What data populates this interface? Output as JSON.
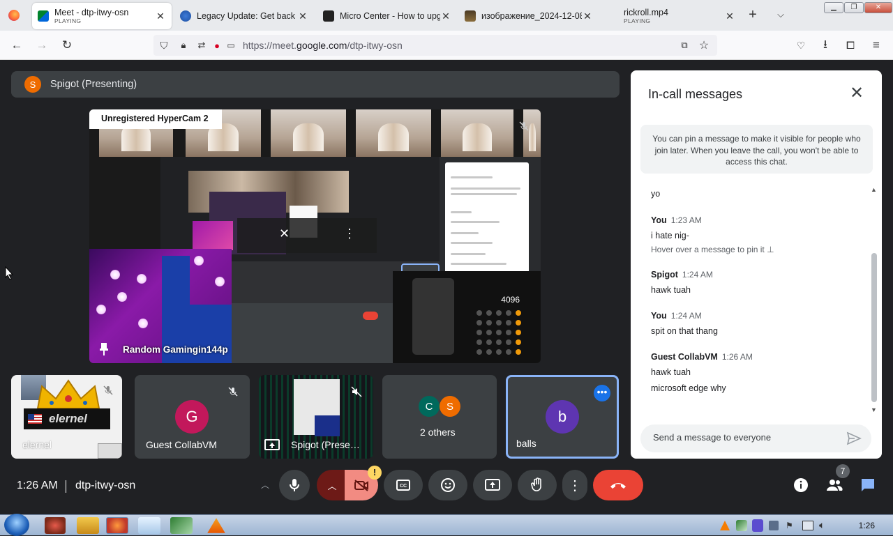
{
  "browser": {
    "tabs": [
      {
        "title": "Meet - dtp-itwy-osn",
        "status": "PLAYING",
        "active": true
      },
      {
        "title": "Legacy Update: Get back o",
        "status": ""
      },
      {
        "title": "Micro Center - How to upg",
        "status": ""
      },
      {
        "title": "изображение_2024-12-08_",
        "status": ""
      },
      {
        "title": "rickroll.mp4",
        "status": "PLAYING"
      }
    ],
    "url_prefix": "https://meet.",
    "url_domain": "google.com",
    "url_path": "/dtp-itwy-osn"
  },
  "meet": {
    "presenting_initial": "S",
    "presenting_label": "Spigot (Presenting)",
    "share": {
      "hypercam_label": "Unregistered HyperCam 2",
      "presenter_name": "Random Gamingin144p",
      "calc_display": "4096"
    },
    "tiles": [
      {
        "name": "elernel",
        "badge": "elernel"
      },
      {
        "name": "Guest CollabVM",
        "initial": "G"
      },
      {
        "name": "Spigot (Prese…"
      },
      {
        "name": "2 others",
        "initials": [
          "C",
          "S"
        ]
      },
      {
        "name": "balls",
        "initial": "b"
      }
    ],
    "chat": {
      "title": "In-call messages",
      "pin_note": "You can pin a message to make it visible for people who join later. When you leave the call, you won't be able to access this chat.",
      "messages": [
        {
          "text": "yo"
        },
        {
          "sender": "You",
          "time": "1:23 AM",
          "lines": [
            "i hate nig-"
          ],
          "hint": "Hover over a message to pin it"
        },
        {
          "sender": "Spigot",
          "time": "1:24 AM",
          "lines": [
            "hawk tuah"
          ]
        },
        {
          "sender": "You",
          "time": "1:24 AM",
          "lines": [
            "spit on that thang"
          ]
        },
        {
          "sender": "Guest CollabVM",
          "time": "1:26 AM",
          "lines": [
            "hawk tuah",
            "microsoft edge why"
          ]
        }
      ],
      "input_placeholder": "Send a message to everyone"
    },
    "bottom": {
      "clock": "1:26 AM",
      "meeting_code": "dtp-itwy-osn",
      "people_count": "7",
      "camera_warning": "!"
    }
  },
  "taskbar": {
    "clock": "1:26"
  },
  "colors": {
    "meet_bg": "#202124",
    "tile_bg": "#3c4043",
    "end_call": "#ea4335",
    "active_tile_border": "#8ab4f8",
    "camera_off": "#f28b82"
  }
}
